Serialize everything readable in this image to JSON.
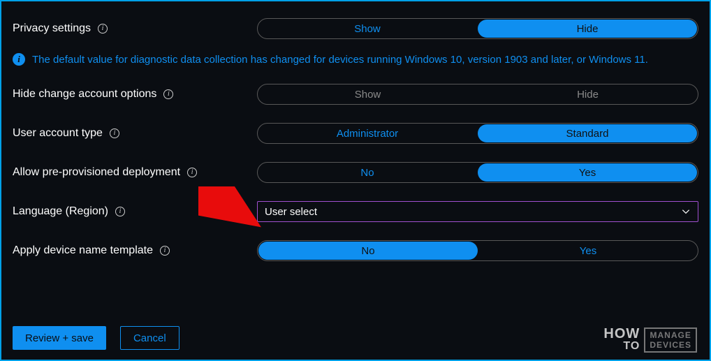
{
  "rows": {
    "privacy": {
      "label": "Privacy settings",
      "opt_left": "Show",
      "opt_right": "Hide"
    },
    "banner": {
      "text": "The default value for diagnostic data collection has changed for devices running Windows 10, version 1903 and later, or Windows 11."
    },
    "hide_change": {
      "label": "Hide change account options",
      "opt_left": "Show",
      "opt_right": "Hide"
    },
    "user_account": {
      "label": "User account type",
      "opt_left": "Administrator",
      "opt_right": "Standard"
    },
    "allow_preprov": {
      "label": "Allow pre-provisioned deployment",
      "opt_left": "No",
      "opt_right": "Yes"
    },
    "language": {
      "label": "Language (Region)",
      "value": "User select"
    },
    "device_template": {
      "label": "Apply device name template",
      "opt_left": "No",
      "opt_right": "Yes"
    }
  },
  "footer": {
    "review": "Review + save",
    "cancel": "Cancel"
  },
  "watermark": {
    "how": "HOW",
    "to": "TO",
    "manage": "MANAGE",
    "devices": "DEVICES"
  }
}
